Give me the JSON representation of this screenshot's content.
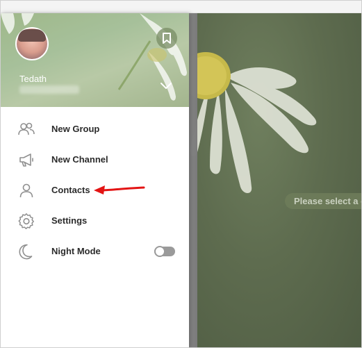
{
  "window": {
    "accent_color": "#ff0000"
  },
  "profile": {
    "name": "Tedath",
    "bookmark_icon": "bookmark-icon",
    "expand_icon": "chevron-down-icon"
  },
  "menu": {
    "items": [
      {
        "label": "New Group",
        "icon": "group-icon"
      },
      {
        "label": "New Channel",
        "icon": "megaphone-icon"
      },
      {
        "label": "Contacts",
        "icon": "user-icon"
      },
      {
        "label": "Settings",
        "icon": "gear-icon"
      },
      {
        "label": "Night Mode",
        "icon": "moon-icon",
        "toggle_on": false
      }
    ]
  },
  "chat": {
    "placeholder": "Please select a c"
  }
}
